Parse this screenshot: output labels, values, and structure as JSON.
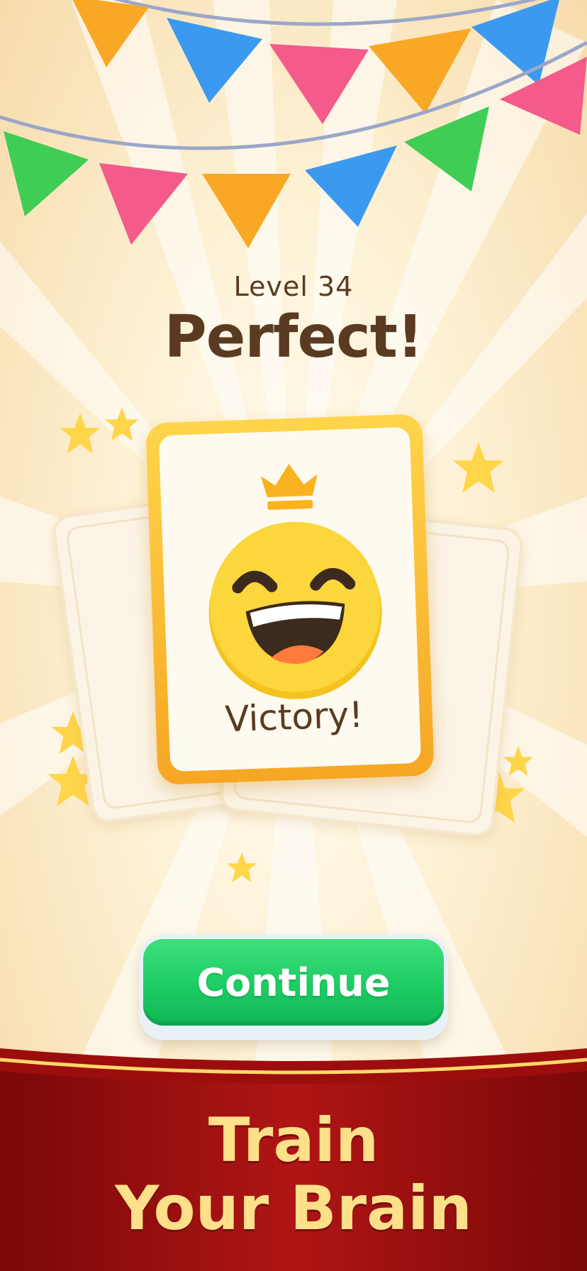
{
  "level": {
    "label": "Level 34"
  },
  "headline": "Perfect!",
  "card": {
    "caption": "Victory!",
    "emoji_icon": "laughing-face-icon",
    "crown_icon": "crown-icon"
  },
  "continue_button": {
    "label": "Continue"
  },
  "promo": {
    "line1": "Train",
    "line2": "Your Brain"
  },
  "colors": {
    "background": "#fdf1d4",
    "text_brown": "#5a3b22",
    "card_border": "#f6a623",
    "button_green": "#1dcb63",
    "banner_red": "#9c0e0e",
    "banner_text": "#ffe08a"
  }
}
